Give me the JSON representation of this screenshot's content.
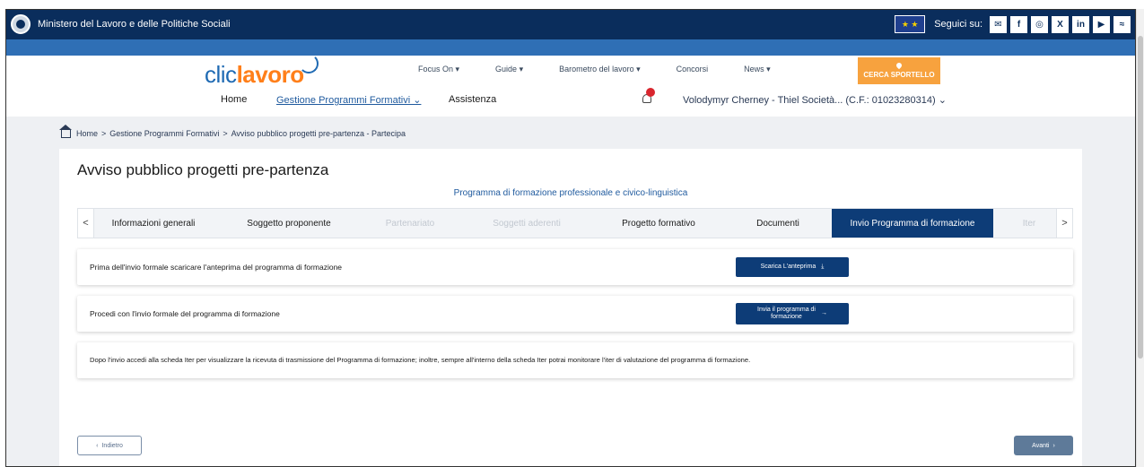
{
  "gov_bar": {
    "ministry": "Ministero del Lavoro e delle Politiche Sociali",
    "follow_label": "Seguici su:",
    "social_icons": [
      "mail-icon",
      "facebook-icon",
      "instagram-icon",
      "x-icon",
      "linkedin-icon",
      "youtube-icon",
      "rss-icon"
    ],
    "social_glyphs": [
      "✉",
      "f",
      "◎",
      "X",
      "in",
      "▶",
      "≈"
    ],
    "color": "#0a2d5c"
  },
  "header": {
    "logo_part1": "clic",
    "logo_part2": "lavoro",
    "top_links": [
      "Focus On ▾",
      "Guide ▾",
      "Barometro del lavoro ▾",
      "Concorsi",
      "News ▾"
    ],
    "cerca_label": "CERCA SPORTELLO",
    "main_nav": {
      "home": "Home",
      "gestione": "Gestione Programmi Formativi ⌄",
      "assistenza": "Assistenza"
    },
    "user": "Volodymyr Cherney - Thiel Società... (C.F.: 01023280314) ⌄"
  },
  "breadcrumb": {
    "home": "Home",
    "sep1": ">",
    "level1": "Gestione Programmi Formativi",
    "sep2": ">",
    "level2": "Avviso pubblico progetti pre-partenza - Partecipa"
  },
  "page": {
    "title": "Avviso pubblico progetti pre-partenza",
    "subtitle": "Programma di formazione professionale e civico-linguistica"
  },
  "tabs": {
    "prev": "<",
    "next": ">",
    "items": [
      {
        "label": "Informazioni generali",
        "state": "normal"
      },
      {
        "label": "Soggetto proponente",
        "state": "normal"
      },
      {
        "label": "Partenariato",
        "state": "disabled"
      },
      {
        "label": "Soggetti aderenti",
        "state": "disabled"
      },
      {
        "label": "Progetto formativo",
        "state": "normal"
      },
      {
        "label": "Documenti",
        "state": "normal"
      },
      {
        "label": "Invio Programma di formazione",
        "state": "active"
      },
      {
        "label": "Iter",
        "state": "disabled"
      }
    ]
  },
  "rows": {
    "preview_text": "Prima dell'invio formale scaricare l'anteprima del programma di formazione",
    "preview_button": "Scarica L'anteprima",
    "send_text": "Procedi con l'invio formale del programma di formazione",
    "send_button_line1": "Invia il programma di",
    "send_button_line2": "formazione",
    "info_text": "Dopo l'invio accedi alla scheda Iter per visualizzare la ricevuta di trasmissione del Programma di formazione; inoltre, sempre all'interno della scheda Iter potrai monitorare l'iter di valutazione del programma di formazione."
  },
  "footer_buttons": {
    "back": "Indietro",
    "next": "Avanti"
  }
}
